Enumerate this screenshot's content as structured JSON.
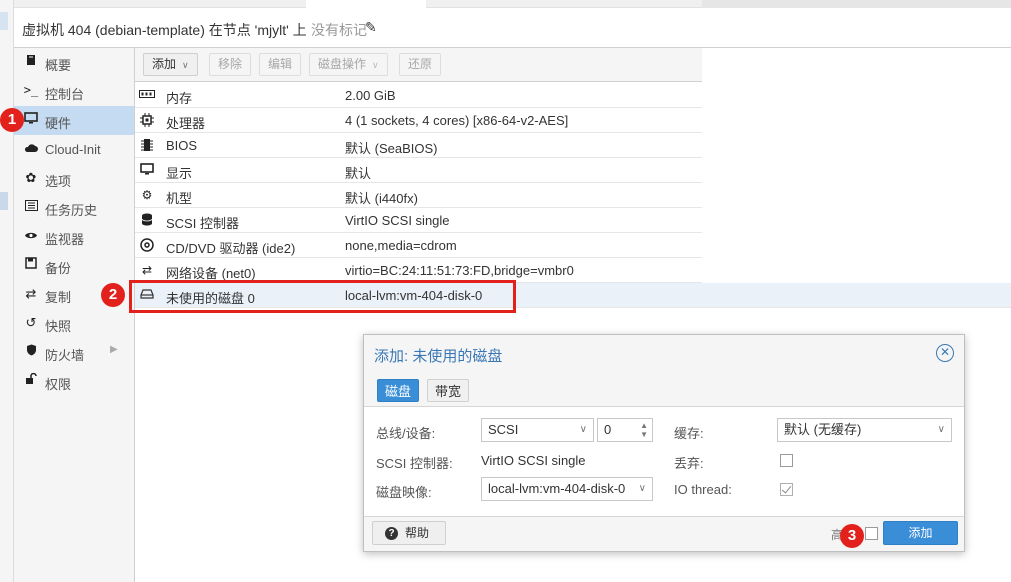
{
  "header": {
    "title": "虚拟机 404 (debian-template) 在节点 'mjylt' 上",
    "tags_placeholder": "没有标记"
  },
  "nav": {
    "items": [
      {
        "label": "概要",
        "icon": "book-icon",
        "selected": false
      },
      {
        "label": "控制台",
        "icon": "terminal-icon",
        "selected": false
      },
      {
        "label": "硬件",
        "icon": "desktop-icon",
        "selected": true
      },
      {
        "label": "Cloud-Init",
        "icon": "cloud-icon",
        "selected": false
      },
      {
        "label": "选项",
        "icon": "gear-icon",
        "selected": false
      },
      {
        "label": "任务历史",
        "icon": "list-icon",
        "selected": false
      },
      {
        "label": "监视器",
        "icon": "eye-icon",
        "selected": false
      },
      {
        "label": "备份",
        "icon": "floppy-icon",
        "selected": false
      },
      {
        "label": "复制",
        "icon": "retweet-icon",
        "selected": false
      },
      {
        "label": "快照",
        "icon": "history-icon",
        "selected": false
      },
      {
        "label": "防火墙",
        "icon": "shield-icon",
        "selected": false
      },
      {
        "label": "权限",
        "icon": "unlock-icon",
        "selected": false
      }
    ]
  },
  "toolbar": {
    "add": "添加",
    "remove": "移除",
    "edit": "编辑",
    "disk_action": "磁盘操作",
    "revert": "还原"
  },
  "hardware": [
    {
      "name": "内存",
      "value": "2.00 GiB",
      "icon": "memory-icon"
    },
    {
      "name": "处理器",
      "value": "4 (1 sockets, 4 cores) [x86-64-v2-AES]",
      "icon": "cpu-icon"
    },
    {
      "name": "BIOS",
      "value": "默认 (SeaBIOS)",
      "icon": "microchip-icon"
    },
    {
      "name": "显示",
      "value": "默认",
      "icon": "monitor-icon"
    },
    {
      "name": "机型",
      "value": "默认 (i440fx)",
      "icon": "cogs-icon"
    },
    {
      "name": "SCSI 控制器",
      "value": "VirtIO SCSI single",
      "icon": "database-icon"
    },
    {
      "name": "CD/DVD 驱动器 (ide2)",
      "value": "none,media=cdrom",
      "icon": "cdrom-icon"
    },
    {
      "name": "网络设备 (net0)",
      "value": "virtio=BC:24:11:51:73:FD,bridge=vmbr0",
      "icon": "exchange-icon"
    },
    {
      "name": "未使用的磁盘 0",
      "value": "local-lvm:vm-404-disk-0",
      "icon": "hdd-icon"
    }
  ],
  "annotations": [
    "1",
    "2",
    "3"
  ],
  "dialog": {
    "title": "添加: 未使用的磁盘",
    "tabs": [
      "磁盘",
      "带宽"
    ],
    "bus_label": "总线/设备:",
    "bus_value": "SCSI",
    "device_value": "0",
    "scsi_ctrl_label": "SCSI 控制器:",
    "scsi_ctrl_value": "VirtIO SCSI single",
    "disk_image_label": "磁盘映像:",
    "disk_image_value": "local-lvm:vm-404-disk-0",
    "cache_label": "缓存:",
    "cache_value": "默认 (无缓存)",
    "discard_label": "丢弃:",
    "discard_checked": false,
    "io_thread_label": "IO thread:",
    "io_thread_checked": true,
    "help_label": "帮助",
    "advanced_label": "高",
    "add_label": "添加"
  }
}
